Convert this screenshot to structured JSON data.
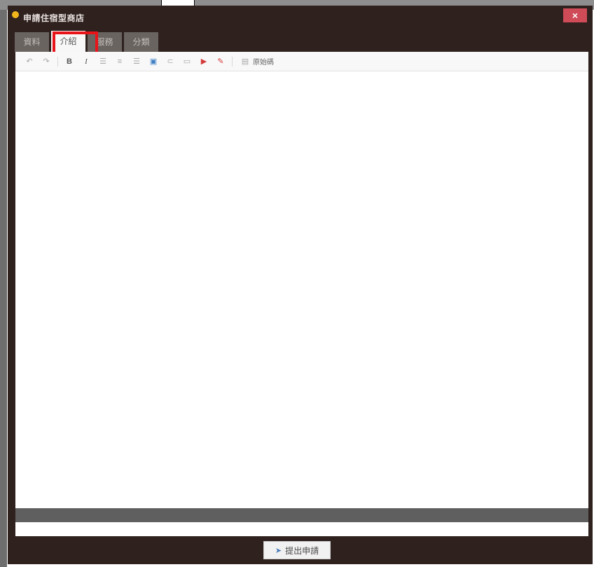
{
  "window": {
    "title": "申請住宿型商店",
    "close_symbol": "×"
  },
  "tabs": [
    {
      "label": "資料",
      "active": false
    },
    {
      "label": "介紹",
      "active": true
    },
    {
      "label": "服務",
      "active": false
    },
    {
      "label": "分類",
      "active": false
    }
  ],
  "toolbar": {
    "icons": [
      "undo-icon",
      "redo-icon",
      "bold-icon",
      "italic-icon",
      "align-left-icon",
      "align-center-icon",
      "align-right-icon",
      "image-icon",
      "link-icon",
      "table-icon",
      "video-icon",
      "eraser-icon",
      "source-icon"
    ],
    "bold_glyph": "B",
    "italic_glyph": "I",
    "source_label": "原始碼"
  },
  "editor": {
    "content": ""
  },
  "footer": {
    "submit_label": "提出申請",
    "submit_icon": "send-icon"
  },
  "colors": {
    "dialog_bg": "#2e211e",
    "close_button": "#cf4b58",
    "highlight": "#e8141a"
  }
}
